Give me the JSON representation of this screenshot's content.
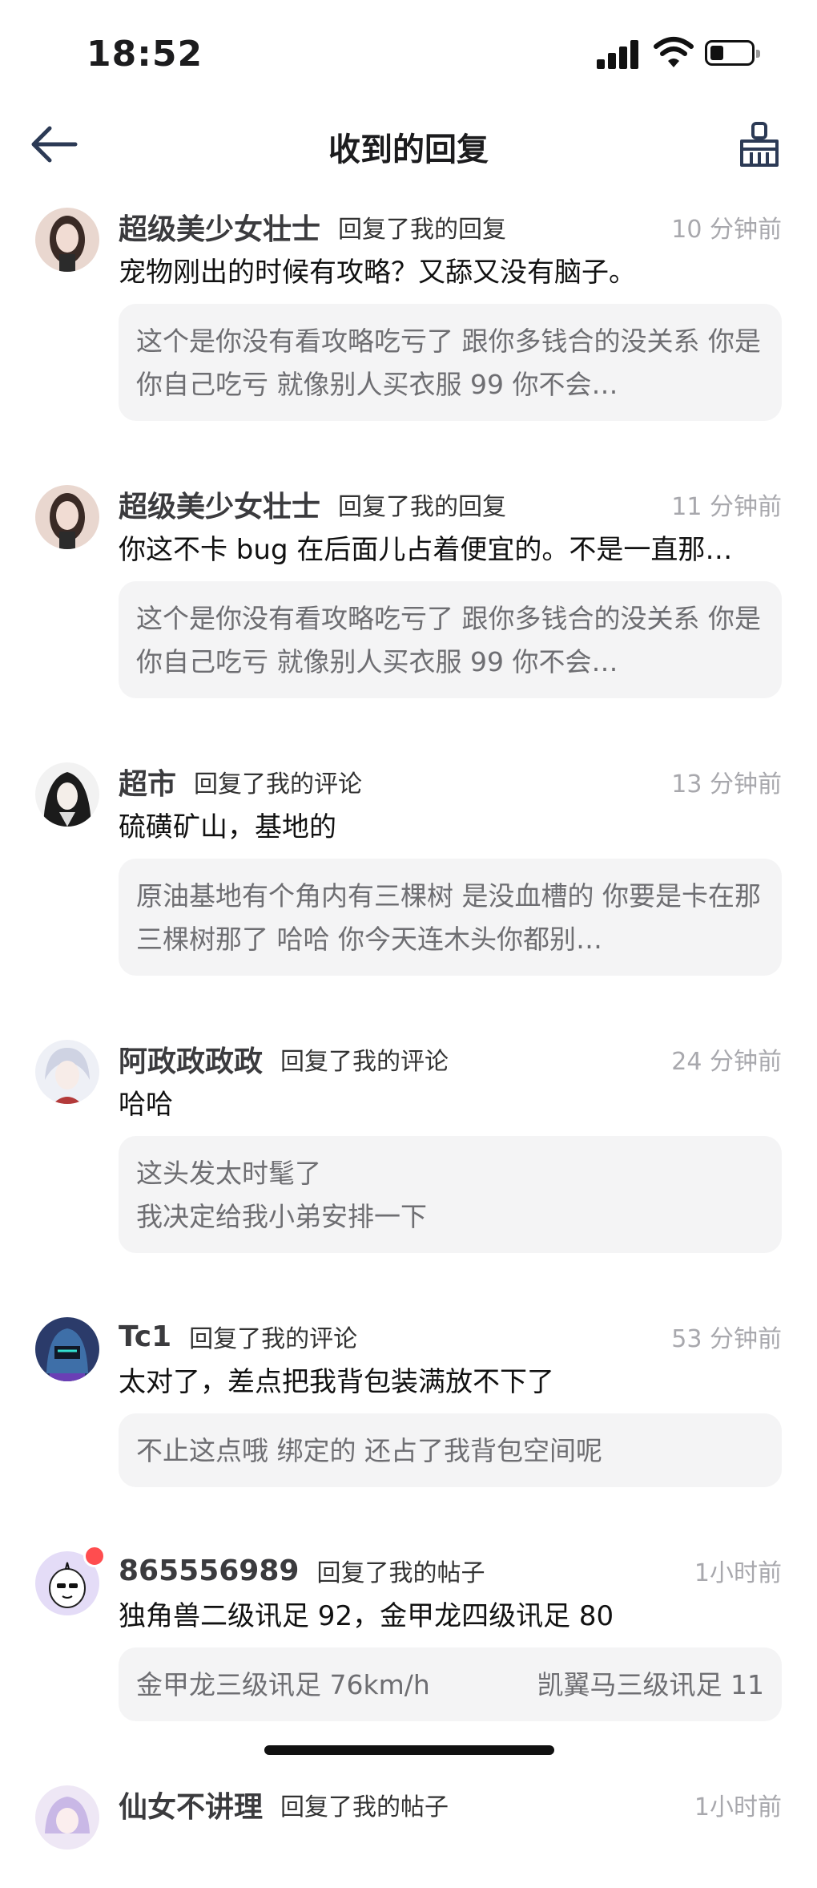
{
  "status_bar": {
    "time": "18:52"
  },
  "header": {
    "title": "收到的回复"
  },
  "replies": [
    {
      "name": "超级美少女壮士",
      "action": "回复了我的回复",
      "time": "10 分钟前",
      "content": "宠物刚出的时候有攻略？又舔又没有脑子。",
      "quote": "这个是你没有看攻略吃亏了 跟你多钱合的没关系 你是你自己吃亏 就像别人买衣服 99 你不会…"
    },
    {
      "name": "超级美少女壮士",
      "action": "回复了我的回复",
      "time": "11 分钟前",
      "content": "你这不卡 bug 在后面儿占着便宜的。不是一直那…",
      "quote": "这个是你没有看攻略吃亏了 跟你多钱合的没关系 你是你自己吃亏 就像别人买衣服 99 你不会…"
    },
    {
      "name": "超市",
      "action": "回复了我的评论",
      "time": "13 分钟前",
      "content": "硫磺矿山，基地的",
      "quote": "原油基地有个角内有三棵树 是没血槽的 你要是卡在那三棵树那了 哈哈 你今天连木头你都别…"
    },
    {
      "name": "阿政政政政",
      "action": "回复了我的评论",
      "time": "24 分钟前",
      "content": "哈哈",
      "quote_lines": [
        "这头发太时髦了",
        "我决定给我小弟安排一下"
      ]
    },
    {
      "name": "Tc1",
      "action": "回复了我的评论",
      "time": "53 分钟前",
      "content": "太对了，差点把我背包装满放不下了",
      "quote": "不止这点哦 绑定的 还占了我背包空间呢"
    },
    {
      "name": "865556989",
      "action": "回复了我的帖子",
      "time": "1小时前",
      "content": "独角兽二级讯足 92，金甲龙四级讯足 80",
      "quote_cols": [
        "金甲龙三级讯足 76km/h",
        "凯翼马三级讯足 11"
      ]
    },
    {
      "name": "仙女不讲理",
      "action": "回复了我的帖子",
      "time": "1小时前"
    }
  ]
}
